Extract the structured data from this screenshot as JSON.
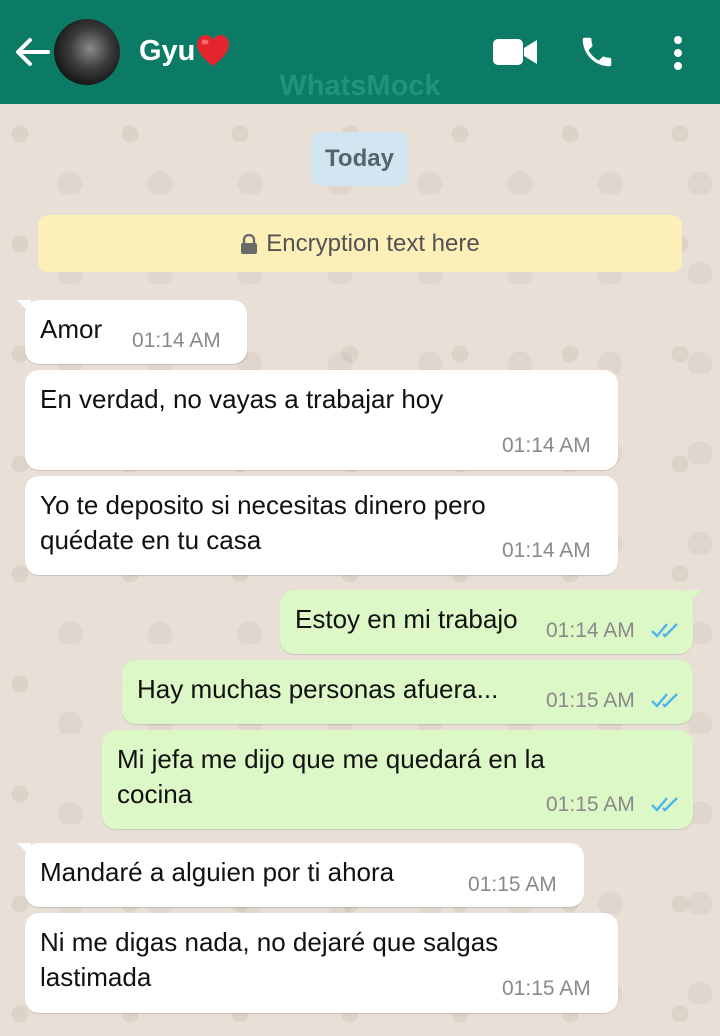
{
  "header": {
    "contact_name": "Gyu",
    "watermark": "WhatsMock",
    "icons": [
      "back-arrow-icon",
      "heart-icon",
      "video-call-icon",
      "phone-icon",
      "more-vert-icon"
    ],
    "bar_color": "#0b7b66"
  },
  "chat": {
    "date_label": "Today",
    "encryption_text": "Encryption text here",
    "messages": [
      {
        "direction": "in",
        "lines": [
          "Amor"
        ],
        "time": "01:14 AM"
      },
      {
        "direction": "in",
        "lines": [
          "En verdad, no vayas a trabajar hoy"
        ],
        "time": "01:14 AM"
      },
      {
        "direction": "in",
        "lines": [
          "Yo te deposito si necesitas dinero pero",
          "quédate en tu casa"
        ],
        "time": "01:14 AM"
      },
      {
        "direction": "out",
        "lines": [
          "Estoy en mi trabajo"
        ],
        "time": "01:14 AM",
        "status": "read"
      },
      {
        "direction": "out",
        "lines": [
          "Hay muchas personas afuera..."
        ],
        "time": "01:15 AM",
        "status": "read"
      },
      {
        "direction": "out",
        "lines": [
          "Mi jefa me dijo que me quedará en la",
          "cocina"
        ],
        "time": "01:15 AM",
        "status": "read"
      },
      {
        "direction": "in",
        "lines": [
          "Mandaré a alguien por ti ahora"
        ],
        "time": "01:15 AM"
      },
      {
        "direction": "in",
        "lines": [
          "Ni me digas nada, no dejaré que salgas",
          "lastimada"
        ],
        "time": "01:15 AM"
      }
    ]
  },
  "colors": {
    "incoming_bubble": "#ffffff",
    "outgoing_bubble": "#dcf8c6",
    "read_ticks": "#4fb6ec",
    "chat_background": "#e8dfd6"
  }
}
